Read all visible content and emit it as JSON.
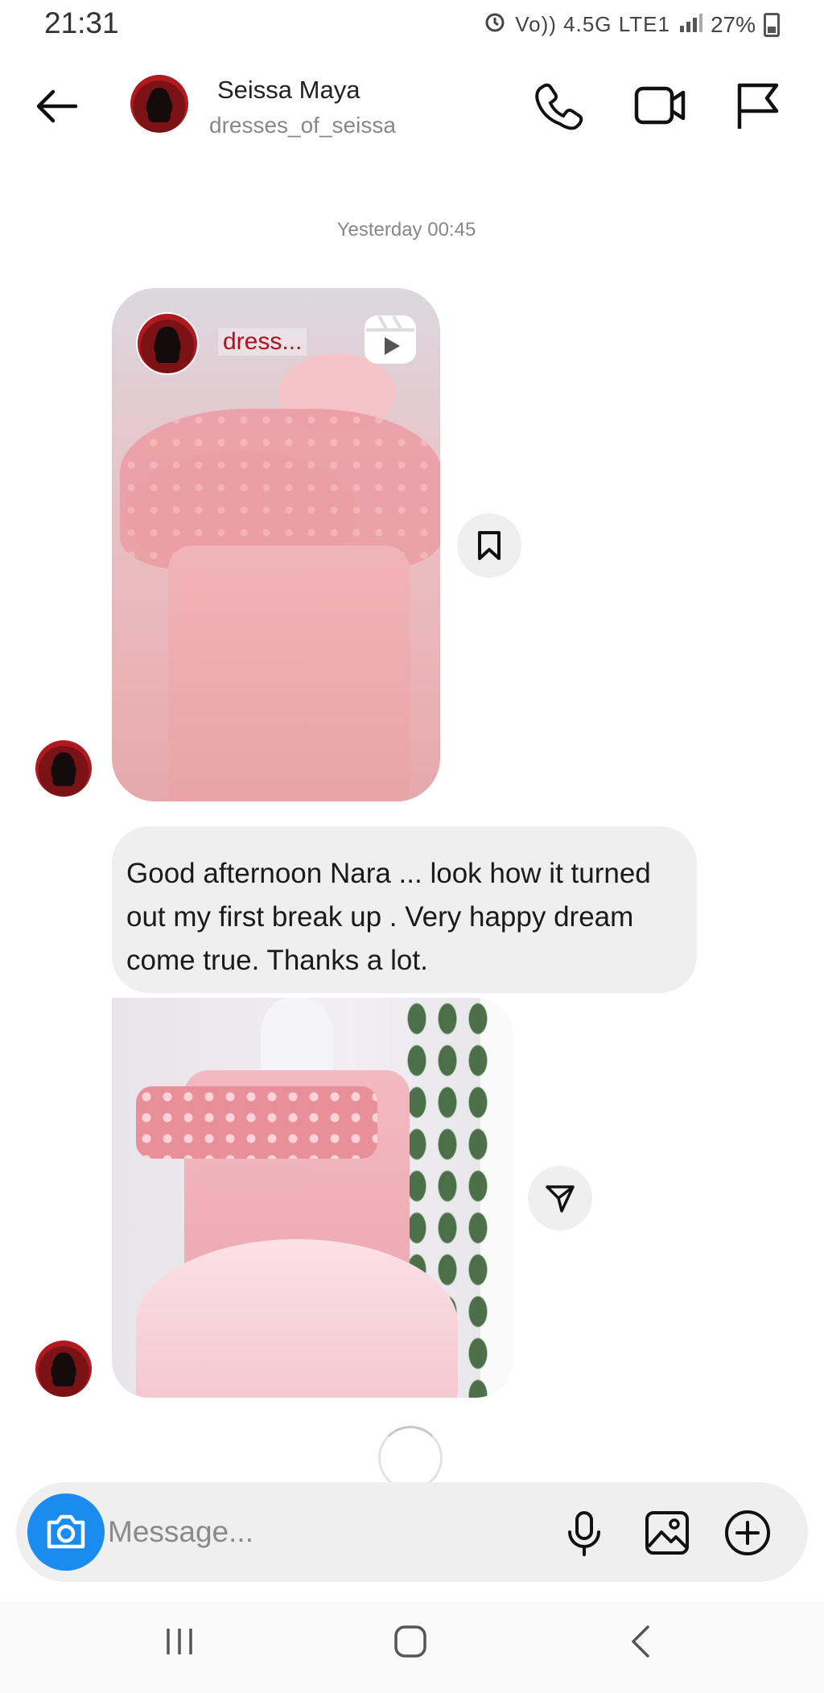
{
  "status_bar": {
    "time": "21:31",
    "network": "Vo)) 4.5G LTE1",
    "battery": "27%"
  },
  "header": {
    "name": "Seissa Maya",
    "handle": "dresses_of_seissa",
    "icons": [
      "back-arrow-icon",
      "phone-icon",
      "video-camera-icon",
      "flag-icon"
    ]
  },
  "thread": {
    "timestamp": "Yesterday 00:45",
    "reel": {
      "author": "dress...",
      "icons": [
        "reels-icon",
        "bookmark-icon"
      ]
    },
    "message": {
      "text": "Good afternoon Nara ... look how it turned out my first break up . Very happy dream come true. Thanks a lot."
    },
    "photo": {
      "icons": [
        "send-icon"
      ]
    }
  },
  "composer": {
    "placeholder": "Message...",
    "icons": [
      "camera-icon",
      "microphone-icon",
      "gallery-icon",
      "plus-circle-icon"
    ]
  },
  "colors": {
    "accent": "#1a8cf0",
    "bubble": "#efefef",
    "author_name": "#b01020"
  }
}
